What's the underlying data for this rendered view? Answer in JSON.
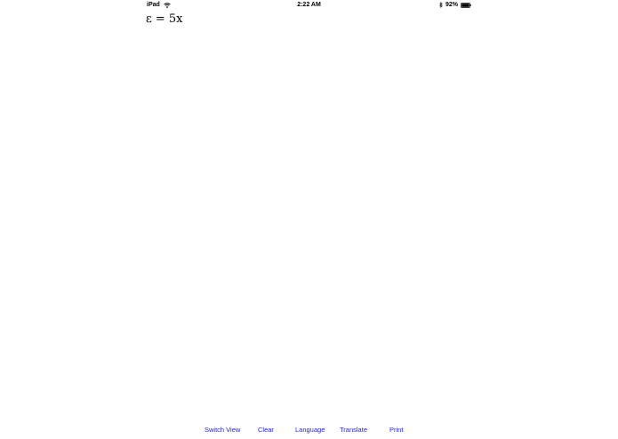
{
  "status_bar": {
    "carrier": "iPad",
    "time": "2:22 AM",
    "battery_percent": "92%",
    "battery_level": 0.92,
    "icons": [
      "wifi-icon",
      "bluetooth-icon",
      "battery-icon"
    ]
  },
  "equation": {
    "text": "ε = 5x"
  },
  "toolbar": {
    "switch_view_label": "Switch View",
    "clear_label": "Clear",
    "language_label": "Language",
    "translate_label": "Translate",
    "print_label": "Print"
  },
  "colors": {
    "accent": "#1a1aff",
    "background": "#ffffff",
    "text": "#000000"
  }
}
